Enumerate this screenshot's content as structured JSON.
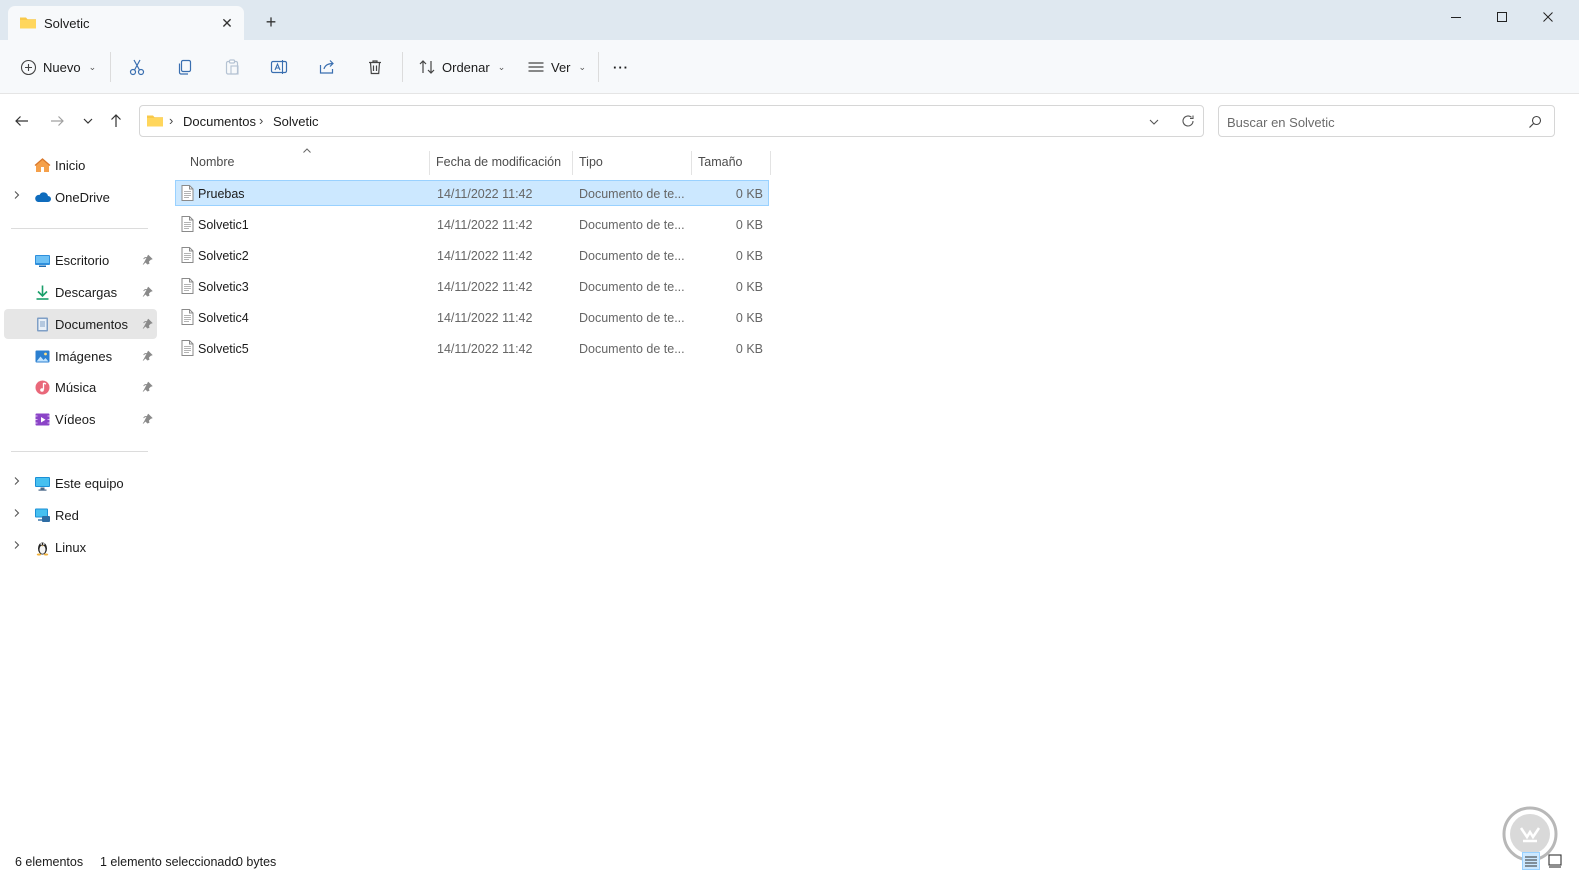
{
  "window": {
    "tab_title": "Solvetic",
    "new_tab": "+",
    "close_tab": "✕"
  },
  "toolbar": {
    "new_label": "Nuevo",
    "sort_label": "Ordenar",
    "view_label": "Ver",
    "more_label": "···"
  },
  "address": {
    "crumbs": [
      "Documentos",
      "Solvetic"
    ],
    "separator": "›"
  },
  "search": {
    "placeholder": "Buscar en Solvetic"
  },
  "sidebar": {
    "items": [
      {
        "label": "Inicio",
        "icon": "home-icon",
        "expandable": false,
        "pinned": false
      },
      {
        "label": "OneDrive",
        "icon": "cloud-icon",
        "expandable": true,
        "pinned": false
      },
      {
        "label": "Escritorio",
        "icon": "desktop-icon",
        "expandable": false,
        "pinned": true
      },
      {
        "label": "Descargas",
        "icon": "download-icon",
        "expandable": false,
        "pinned": true
      },
      {
        "label": "Documentos",
        "icon": "documents-icon",
        "expandable": false,
        "pinned": true,
        "selected": true
      },
      {
        "label": "Imágenes",
        "icon": "pictures-icon",
        "expandable": false,
        "pinned": true
      },
      {
        "label": "Música",
        "icon": "music-icon",
        "expandable": false,
        "pinned": true
      },
      {
        "label": "Vídeos",
        "icon": "videos-icon",
        "expandable": false,
        "pinned": true
      },
      {
        "label": "Este equipo",
        "icon": "pc-icon",
        "expandable": true,
        "pinned": false
      },
      {
        "label": "Red",
        "icon": "network-icon",
        "expandable": true,
        "pinned": false
      },
      {
        "label": "Linux",
        "icon": "linux-icon",
        "expandable": true,
        "pinned": false
      }
    ]
  },
  "columns": {
    "name": "Nombre",
    "date": "Fecha de modificación",
    "type": "Tipo",
    "size": "Tamaño"
  },
  "files": [
    {
      "name": "Pruebas",
      "date": "14/11/2022 11:42",
      "type": "Documento de te...",
      "size": "0 KB",
      "selected": true
    },
    {
      "name": "Solvetic1",
      "date": "14/11/2022 11:42",
      "type": "Documento de te...",
      "size": "0 KB"
    },
    {
      "name": "Solvetic2",
      "date": "14/11/2022 11:42",
      "type": "Documento de te...",
      "size": "0 KB"
    },
    {
      "name": "Solvetic3",
      "date": "14/11/2022 11:42",
      "type": "Documento de te...",
      "size": "0 KB"
    },
    {
      "name": "Solvetic4",
      "date": "14/11/2022 11:42",
      "type": "Documento de te...",
      "size": "0 KB"
    },
    {
      "name": "Solvetic5",
      "date": "14/11/2022 11:42",
      "type": "Documento de te...",
      "size": "0 KB"
    }
  ],
  "status": {
    "count": "6 elementos",
    "selection": "1 elemento seleccionado",
    "bytes": "0 bytes"
  },
  "colors": {
    "titlebar": "#dfe8f0",
    "selection": "#cce8ff",
    "selection_border": "#99d1ff",
    "folder": "#f8c94a",
    "accent": "#0067c0"
  }
}
